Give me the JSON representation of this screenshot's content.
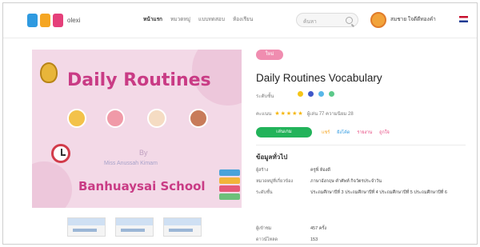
{
  "header": {
    "logo_text": "olexi",
    "nav": [
      "หน้าแรก",
      "หมวดหมู่",
      "แบบทดสอบ",
      "ห้องเรียน"
    ],
    "search_placeholder": "ค้นหา",
    "user_name": "สมชาย ใจดีดีทองคำ"
  },
  "hero": {
    "title": "Daily Routines",
    "by": "By",
    "author": "Miss Anussah Kimam",
    "school": "Banhuaysai School"
  },
  "detail": {
    "badge": "ใหม่",
    "title": "Daily Routines Vocabulary",
    "row1_label": "ระดับชั้น",
    "row2_text": "คะแนน",
    "stars": "★★★★★",
    "row2_extra": "ผู้เล่น 77  ความนิยม 28",
    "main_button": "เล่นเกม",
    "links": [
      "แชร์",
      "ฝังโค้ด",
      "รายงาน",
      "ถูกใจ"
    ],
    "section_title": "ข้อมูลทั่วไป",
    "info": [
      {
        "k": "ผู้สร้าง",
        "v": "ครูพี่ ห้องดี"
      },
      {
        "k": "หมวดหมู่ที่เกี่ยวข้อง",
        "v": "ภาษาอังกฤษ คำศัพท์ กิจวัตรประจำวัน"
      },
      {
        "k": "ระดับชั้น",
        "v": "ประถมศึกษาปีที่ 3 ประถมศึกษาปีที่ 4 ประถมศึกษาปีที่ 5 ประถมศึกษาปีที่ 6"
      },
      {
        "k": "ผู้เข้าชม",
        "v": "457 ครั้ง"
      },
      {
        "k": "ดาวน์โหลด",
        "v": "153"
      }
    ]
  },
  "colors": {
    "accent_green": "#22b35a",
    "accent_pink": "#c93b85",
    "badge_pink": "#f08db0"
  }
}
